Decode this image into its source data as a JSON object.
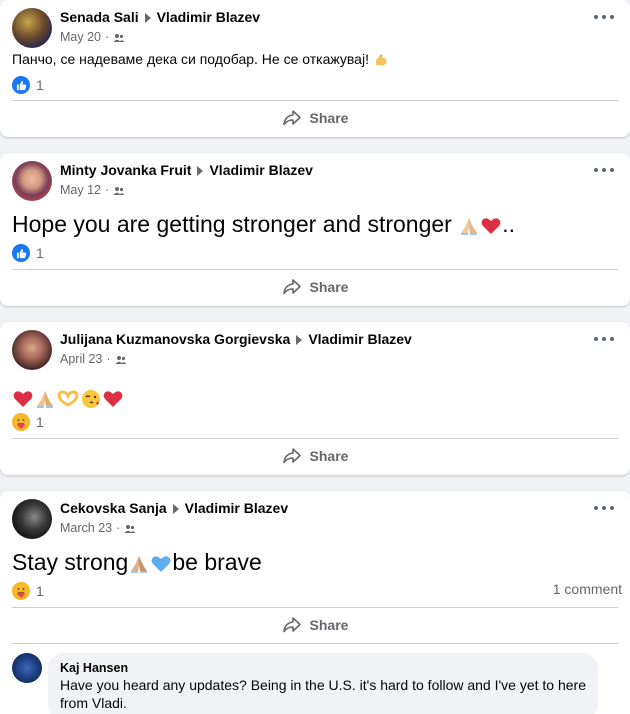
{
  "posts": [
    {
      "author": "Senada Sali",
      "recipient": "Vladimir Blazev",
      "date": "May 20",
      "text": "Панчо, се надеваме дека си подобар. Не се откажувај!",
      "reaction_icon": "like-icon",
      "reaction_count": "1",
      "share_label": "Share"
    },
    {
      "author": "Minty Jovanka Fruit",
      "recipient": "Vladimir Blazev",
      "date": "May 12",
      "text": "Hope you are getting stronger and stronger",
      "text_suffix": "..",
      "reaction_icon": "like-icon",
      "reaction_count": "1",
      "share_label": "Share"
    },
    {
      "author": "Julijana Kuzmanovska Gorgievska",
      "recipient": "Vladimir Blazev",
      "date": "April 23",
      "reaction_icon": "care-icon",
      "reaction_count": "1",
      "share_label": "Share"
    },
    {
      "author": "Cekovska Sanja",
      "recipient": "Vladimir Blazev",
      "date": "March 23",
      "text_a": "Stay strong",
      "text_b": "be brave",
      "reaction_icon": "care-icon",
      "reaction_count": "1",
      "comment_count": "1 comment",
      "share_label": "Share"
    }
  ],
  "comment": {
    "author": "Kaj Hansen",
    "text": "Have you heard any updates? Being in the U.S. it's hard to follow and I've yet to here from Vladi."
  },
  "colors": {
    "like_blue": "#1877f2",
    "secondary_text": "#65676b",
    "background": "#f0f2f5"
  }
}
